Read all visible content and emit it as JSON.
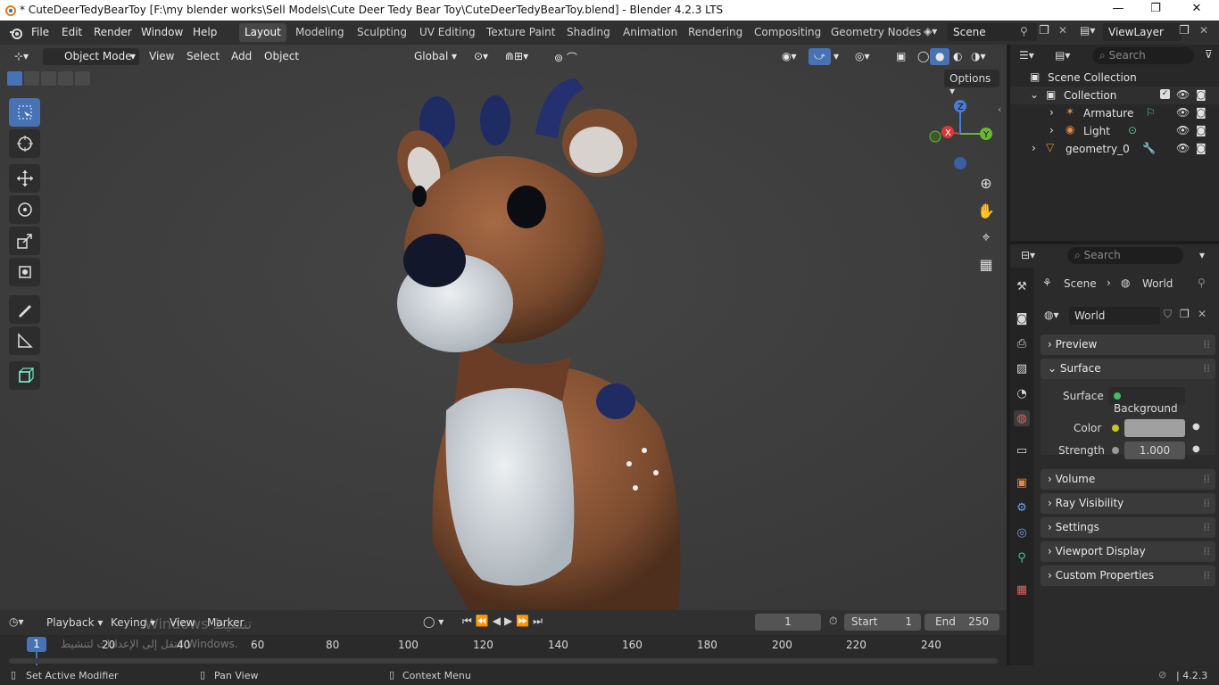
{
  "window": {
    "title": "* CuteDeerTedyBearToy [F:\\my blender works\\Sell Models\\Cute Deer Tedy Bear Toy\\CuteDeerTedyBearToy.blend] - Blender 4.2.3 LTS",
    "minimize": "—",
    "maximize": "❐",
    "close": "✕"
  },
  "menubar": {
    "items": [
      "File",
      "Edit",
      "Render",
      "Window",
      "Help"
    ]
  },
  "workspaces": [
    "Layout",
    "Modeling",
    "Sculpting",
    "UV Editing",
    "Texture Paint",
    "Shading",
    "Animation",
    "Rendering",
    "Compositing",
    "Geometry Nodes"
  ],
  "active_workspace": "Layout",
  "scene_name": "Scene",
  "view_layer": "ViewLayer",
  "viewport": {
    "mode": "Object Mode",
    "menus": [
      "View",
      "Select",
      "Add",
      "Object"
    ],
    "transform_orientation": "Global",
    "options_label": "Options",
    "search_placeholder": "Search"
  },
  "outliner": {
    "root": "Scene Collection",
    "items": [
      {
        "name": "Collection",
        "depth": 1
      },
      {
        "name": "Armature",
        "depth": 2
      },
      {
        "name": "Light",
        "depth": 2
      },
      {
        "name": "geometry_0",
        "depth": 1
      }
    ]
  },
  "properties": {
    "search_placeholder": "Search",
    "breadcrumb": [
      "Scene",
      "World"
    ],
    "datablock": "World",
    "panels": {
      "preview": "Preview",
      "surface": "Surface",
      "volume": "Volume",
      "ray_visibility": "Ray Visibility",
      "settings": "Settings",
      "viewport_display": "Viewport Display",
      "custom_properties": "Custom Properties"
    },
    "surface_label": "Surface",
    "surface_value": "Background",
    "color_label": "Color",
    "strength_label": "Strength",
    "strength_value": "1.000"
  },
  "timeline": {
    "menus": [
      "Playback",
      "Keying",
      "View",
      "Marker"
    ],
    "current_frame": "1",
    "start_label": "Start",
    "start_value": "1",
    "end_label": "End",
    "end_value": "250",
    "ruler_ticks": [
      "20",
      "40",
      "60",
      "80",
      "100",
      "120",
      "140",
      "160",
      "180",
      "200",
      "220",
      "240"
    ],
    "playhead": "1",
    "watermark_line1": "Windows تنشيط",
    "watermark_line2": "انتقل إلى الإعدادات لتنشيط Windows."
  },
  "statusbar": {
    "left": "Set Active Modifier",
    "mid": "Pan View",
    "right": "Context Menu",
    "version": "4.2.3"
  },
  "colors": {
    "accent": "#4772b3",
    "viewport_bg": "#3d3d3d",
    "panel_bg": "#2b2b2b"
  }
}
